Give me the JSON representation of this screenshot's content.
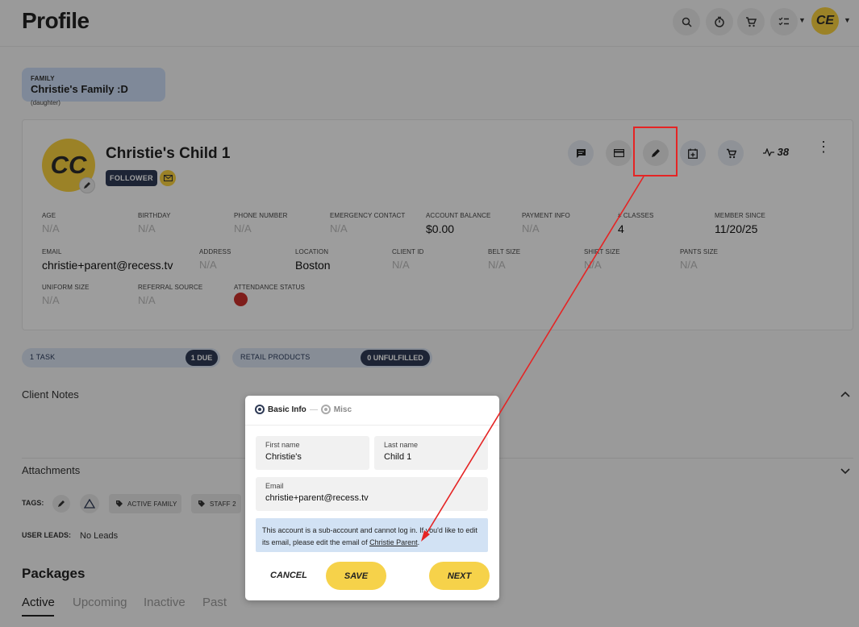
{
  "header": {
    "title": "Profile",
    "icons": [
      "search-icon",
      "timer-icon",
      "cart-icon",
      "checklist-icon"
    ],
    "user_initials": "CE"
  },
  "family": {
    "label": "FAMILY",
    "name": "Christie's Family :D",
    "relation": "(daughter)"
  },
  "profile": {
    "initials": "CC",
    "name": "Christie's Child 1",
    "badge": "FOLLOWER",
    "activity_count": "38",
    "fields": [
      {
        "label": "AGE",
        "value": "N/A"
      },
      {
        "label": "BIRTHDAY",
        "value": "N/A"
      },
      {
        "label": "PHONE NUMBER",
        "value": "N/A"
      },
      {
        "label": "EMERGENCY CONTACT",
        "value": "N/A"
      },
      {
        "label": "ACCOUNT BALANCE",
        "value": "$0.00"
      },
      {
        "label": "PAYMENT INFO",
        "value": "N/A"
      },
      {
        "label": "# CLASSES",
        "value": "4"
      },
      {
        "label": "MEMBER SINCE",
        "value": "11/20/25"
      },
      {
        "label": "EMAIL",
        "value": "christie+parent@recess.tv"
      },
      {
        "label": "ADDRESS",
        "value": "N/A"
      },
      {
        "label": "LOCATION",
        "value": "Boston"
      },
      {
        "label": "CLIENT ID",
        "value": "N/A"
      },
      {
        "label": "BELT SIZE",
        "value": "N/A"
      },
      {
        "label": "SHIRT SIZE",
        "value": "N/A"
      },
      {
        "label": "PANTS SIZE",
        "value": "N/A"
      },
      {
        "label": "UNIFORM SIZE",
        "value": "N/A"
      },
      {
        "label": "REFERRAL SOURCE",
        "value": "N/A"
      },
      {
        "label": "ATTENDANCE STATUS",
        "value": ""
      }
    ],
    "attendance_color": "#c9302c"
  },
  "pills": [
    {
      "label": "1 TASK",
      "badge": "1 DUE"
    },
    {
      "label": "RETAIL PRODUCTS",
      "badge": "0 UNFULFILLED"
    }
  ],
  "sections": {
    "client_notes": "Client Notes",
    "attachments": "Attachments"
  },
  "tags": {
    "label": "TAGS:",
    "chips": [
      "ACTIVE FAMILY",
      "STAFF 2"
    ]
  },
  "leads": {
    "label": "USER LEADS:",
    "value": "No Leads"
  },
  "packages": {
    "title": "Packages",
    "tabs": [
      "Active",
      "Upcoming",
      "Inactive",
      "Past"
    ]
  },
  "modal": {
    "steps": [
      "Basic Info",
      "Misc"
    ],
    "first_name": {
      "label": "First name",
      "value": "Christie's"
    },
    "last_name": {
      "label": "Last name",
      "value": "Child 1"
    },
    "email": {
      "label": "Email",
      "value": "christie+parent@recess.tv"
    },
    "info_text": "This account is a sub-account and cannot log in. If you'd like to edit its email, please edit the email of ",
    "info_link": "Christie Parent",
    "info_end": ".",
    "cancel": "CANCEL",
    "save": "SAVE",
    "next": "NEXT"
  },
  "colors": {
    "accent_yellow": "#f6ce3f",
    "navy": "#2e3a55",
    "annotation_red": "#e52424",
    "info_blue": "#d2e2f4"
  }
}
